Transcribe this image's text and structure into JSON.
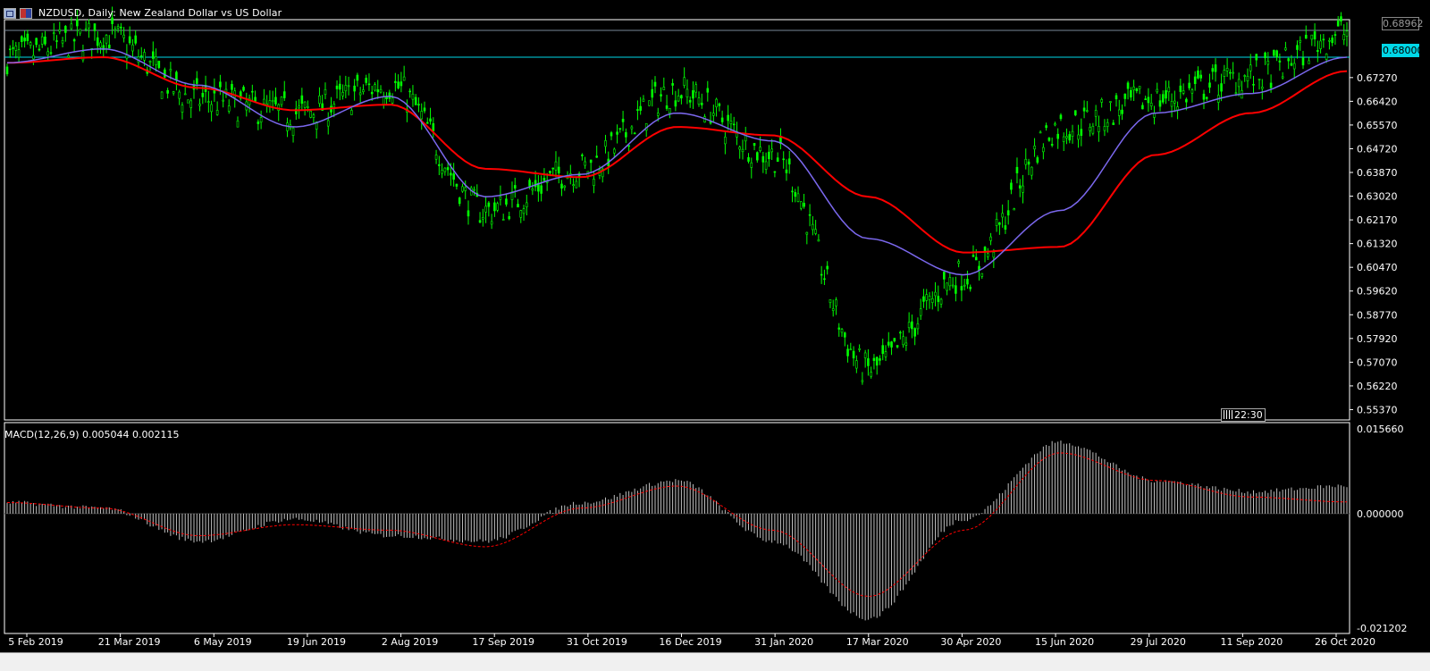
{
  "window": {
    "title": "NZDUSD, Daily:  New Zealand Dollar vs US Dollar",
    "icons": [
      "restore-icon",
      "flag-icon"
    ]
  },
  "price_axis": {
    "labels": [
      "0.68962",
      "0.68000",
      "0.67270",
      "0.66420",
      "0.65570",
      "0.64720",
      "0.63870",
      "0.63020",
      "0.62170",
      "0.61320",
      "0.60470",
      "0.59620",
      "0.58770",
      "0.57920",
      "0.57070",
      "0.56220",
      "0.55370"
    ],
    "current_price_tag": "0.68962",
    "hline_tag": "0.68000"
  },
  "time_tag": "22:30",
  "macd": {
    "label": "MACD(12,26,9) 0.005044 0.002115",
    "axis_labels": [
      "0.015660",
      "0.000000",
      "-0.021202"
    ]
  },
  "time_axis": {
    "labels": [
      "5 Feb 2019",
      "21 Mar 2019",
      "6 May 2019",
      "19 Jun 2019",
      "2 Aug 2019",
      "17 Sep 2019",
      "31 Oct 2019",
      "16 Dec 2019",
      "31 Jan 2020",
      "17 Mar 2020",
      "30 Apr 2020",
      "15 Jun 2020",
      "29 Jul 2020",
      "11 Sep 2020",
      "26 Oct 2020"
    ]
  },
  "colors": {
    "background": "#000000",
    "bull_candle": "#00ff00",
    "ma_fast": "#7b68ee",
    "ma_slow": "#ff0000",
    "hline": "#00d8e8",
    "macd_hist": "#c0c0c0",
    "macd_signal": "#ff0000",
    "grid_axis": "#ffffff"
  },
  "chart_data": [
    {
      "type": "line",
      "title": "NZDUSD, Daily:  New Zealand Dollar vs US Dollar",
      "x": [
        "5 Feb 2019",
        "21 Mar 2019",
        "6 May 2019",
        "19 Jun 2019",
        "2 Aug 2019",
        "17 Sep 2019",
        "31 Oct 2019",
        "16 Dec 2019",
        "31 Jan 2020",
        "17 Mar 2020",
        "30 Apr 2020",
        "15 Jun 2020",
        "29 Jul 2020",
        "11 Sep 2020",
        "26 Oct 2020"
      ],
      "ylim": [
        0.55,
        0.6925
      ],
      "series": [
        {
          "values": [
            0.68,
            0.688,
            0.665,
            0.66,
            0.67,
            0.625,
            0.64,
            0.668,
            0.645,
            0.568,
            0.602,
            0.655,
            0.665,
            0.673,
            0.689
          ]
        },
        {
          "values": [
            0.678,
            0.683,
            0.67,
            0.655,
            0.666,
            0.63,
            0.638,
            0.66,
            0.65,
            0.615,
            0.602,
            0.625,
            0.66,
            0.667,
            0.68
          ]
        },
        {
          "values": [
            0.678,
            0.68,
            0.669,
            0.661,
            0.663,
            0.64,
            0.637,
            0.655,
            0.652,
            0.63,
            0.61,
            0.612,
            0.645,
            0.66,
            0.675
          ]
        }
      ],
      "hlines": [
        0.68962,
        0.68
      ]
    },
    {
      "type": "bar",
      "title": "MACD(12,26,9) 0.005044 0.002115",
      "categories": [
        "5 Feb 2019",
        "21 Mar 2019",
        "6 May 2019",
        "19 Jun 2019",
        "2 Aug 2019",
        "17 Sep 2019",
        "31 Oct 2019",
        "16 Dec 2019",
        "31 Jan 2020",
        "17 Mar 2020",
        "30 Apr 2020",
        "15 Jun 2020",
        "29 Jul 2020",
        "11 Sep 2020",
        "26 Oct 2020"
      ],
      "ylim": [
        -0.021202,
        0.01566
      ],
      "series": [
        {
          "values": [
            0.002,
            0.001,
            -0.005,
            -0.001,
            -0.004,
            -0.005,
            0.002,
            0.006,
            -0.005,
            -0.019,
            -0.001,
            0.013,
            0.006,
            0.004,
            0.005044
          ]
        },
        {
          "values": [
            0.002,
            0.001,
            -0.004,
            -0.002,
            -0.003,
            -0.006,
            0.001,
            0.005,
            -0.003,
            -0.015,
            -0.003,
            0.011,
            0.006,
            0.003,
            0.002115
          ]
        }
      ]
    }
  ]
}
